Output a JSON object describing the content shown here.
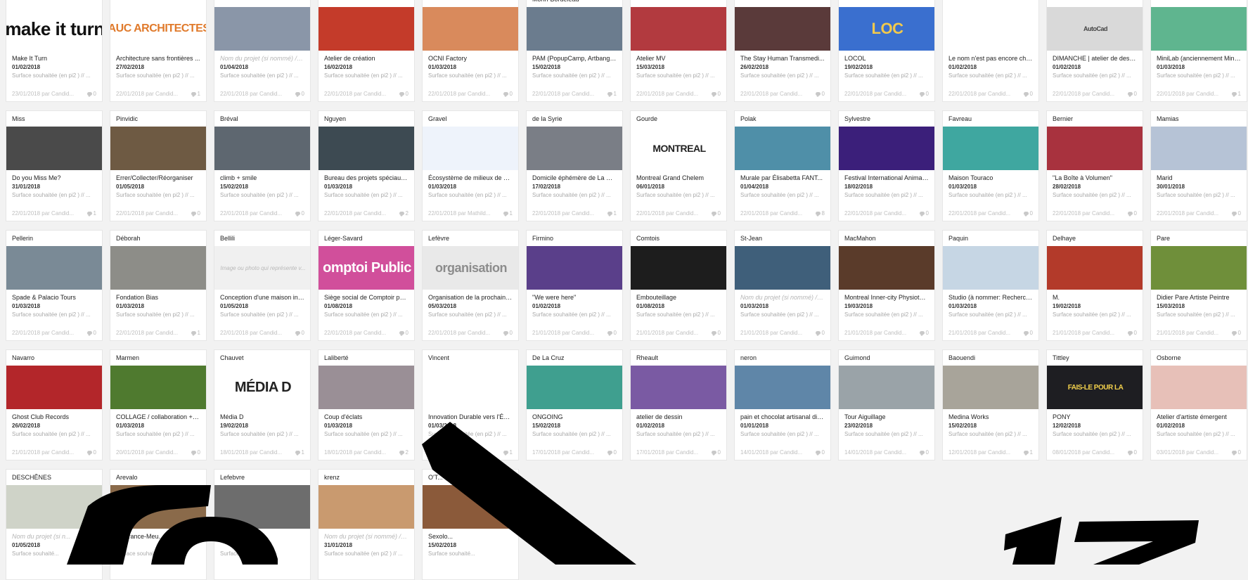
{
  "cards": [
    {
      "header": "",
      "title": "Make It Turn",
      "date": "01/02/2018",
      "surface": "Surface souhaitée (en pi2 ) // ...",
      "meta": "23/01/2018 par Candid...",
      "comments": "0",
      "thumb": {
        "bg": "#ffffff",
        "fg": "#111111",
        "label": "make it turn",
        "size": "26"
      }
    },
    {
      "header": "",
      "title": "Architecture sans frontières ...",
      "date": "27/02/2018",
      "surface": "Surface souhaitée (en pi2 ) // ...",
      "meta": "22/01/2018 par Candid...",
      "comments": "1",
      "thumb": {
        "bg": "#ffffff",
        "fg": "#e07a2b",
        "label": "AUC ARCHITECTES",
        "size": "16"
      }
    },
    {
      "header": "",
      "title": "Nom du projet (si nommé) // ...",
      "title_ph": true,
      "date": "01/04/2018",
      "surface": "Surface souhaitée (en pi2 ) // ...",
      "meta": "22/01/2018 par Candid...",
      "comments": "0",
      "thumb": {
        "bg": "#8a96a8",
        "fg": "#ffffff",
        "label": "",
        "size": "12"
      }
    },
    {
      "header": "",
      "title": "Atelier de création",
      "date": "16/02/2018",
      "surface": "Surface souhaitée (en pi2 ) // ...",
      "meta": "22/01/2018 par Candid...",
      "comments": "0",
      "thumb": {
        "bg": "#c43b2a",
        "fg": "#ffffff",
        "label": "",
        "size": "12"
      }
    },
    {
      "header": "",
      "title": "OCNI Factory",
      "date": "01/03/2018",
      "surface": "Surface souhaitée (en pi2 ) // ...",
      "meta": "22/01/2018 par Candid...",
      "comments": "0",
      "thumb": {
        "bg": "#d98a5c",
        "fg": "#ffffff",
        "label": "",
        "size": "12"
      }
    },
    {
      "header": "Morin-Bordeleau",
      "title": "PAM (PopupCamp, Artbangb...",
      "date": "15/02/2018",
      "surface": "Surface souhaitée (en pi2 ) // ...",
      "meta": "22/01/2018 par Candid...",
      "comments": "1",
      "thumb": {
        "bg": "#6b7c8e",
        "fg": "#ffffff",
        "label": "",
        "size": "12"
      }
    },
    {
      "header": "",
      "title": "Atelier MV",
      "date": "15/03/2018",
      "surface": "Surface souhaitée (en pi2 ) // ...",
      "meta": "22/01/2018 par Candid...",
      "comments": "0",
      "thumb": {
        "bg": "#b23a3f",
        "fg": "#ffffff",
        "label": "",
        "size": "12"
      }
    },
    {
      "header": "",
      "title": "The Stay Human Transmedi...",
      "date": "26/02/2018",
      "surface": "Surface souhaitée (en pi2 ) // ...",
      "meta": "22/01/2018 par Candid...",
      "comments": "0",
      "thumb": {
        "bg": "#5a3a3a",
        "fg": "#ffffff",
        "label": "",
        "size": "12"
      }
    },
    {
      "header": "",
      "title": "LOCOL",
      "date": "19/02/2018",
      "surface": "Surface souhaitée (en pi2 ) // ...",
      "meta": "22/01/2018 par Candid...",
      "comments": "0",
      "thumb": {
        "bg": "#3a6fcf",
        "fg": "#f2c94c",
        "label": "LOC",
        "size": "22"
      }
    },
    {
      "header": "",
      "title": "Le nom n'est pas encore cho...",
      "date": "01/02/2018",
      "surface": "Surface souhaitée (en pi2 ) // ...",
      "meta": "22/01/2018 par Candid...",
      "comments": "0",
      "thumb": {
        "bg": "#ffffff",
        "fg": "#ffffff",
        "label": "",
        "size": "12"
      }
    },
    {
      "header": "",
      "title": "DIMANCHE | atelier de desig...",
      "date": "01/02/2018",
      "surface": "Surface souhaitée (en pi2 ) // ...",
      "meta": "22/01/2018 par Candid...",
      "comments": "0",
      "thumb": {
        "bg": "#d9d9d9",
        "fg": "#444444",
        "label": "AutoCad",
        "size": "9"
      }
    },
    {
      "header": "",
      "title": "MiniLab (anciennement Mini ...",
      "date": "01/03/2018",
      "surface": "Surface souhaitée (en pi2 ) // ...",
      "meta": "22/01/2018 par Candid...",
      "comments": "1",
      "thumb": {
        "bg": "#5fb58f",
        "fg": "#ffffff",
        "label": "",
        "size": "12"
      }
    },
    {
      "header": "Miss",
      "title": "Do you Miss Me?",
      "date": "31/01/2018",
      "surface": "Surface souhaitée (en pi2 ) // ...",
      "meta": "22/01/2018 par Candid...",
      "comments": "1",
      "thumb": {
        "bg": "#4a4a4a",
        "fg": "#ffffff",
        "label": "",
        "size": "12"
      }
    },
    {
      "header": "Pinvidic",
      "title": "Errer/Collecter/Réorganiser",
      "date": "01/05/2018",
      "surface": "Surface souhaitée (en pi2 ) // ...",
      "meta": "22/01/2018 par Candid...",
      "comments": "0",
      "thumb": {
        "bg": "#6e5a43",
        "fg": "#ffffff",
        "label": "",
        "size": "12"
      }
    },
    {
      "header": "Bréval",
      "title": "climb + smile",
      "date": "15/02/2018",
      "surface": "Surface souhaitée (en pi2 ) // ...",
      "meta": "22/01/2018 par Candid...",
      "comments": "0",
      "thumb": {
        "bg": "#5e6770",
        "fg": "#ffffff",
        "label": "",
        "size": "12"
      }
    },
    {
      "header": "Nguyen",
      "title": "Bureau des projets spéciaux ...",
      "date": "01/03/2018",
      "surface": "Surface souhaitée (en pi2 ) // ...",
      "meta": "22/01/2018 par Candid...",
      "comments": "2",
      "thumb": {
        "bg": "#3d4a52",
        "fg": "#ffffff",
        "label": "",
        "size": "12"
      }
    },
    {
      "header": "Gravel",
      "title": "Écosystème de milieux de vi...",
      "date": "01/03/2018",
      "surface": "Surface souhaitée (en pi2 ) // ...",
      "meta": "22/01/2018 par Mathild...",
      "comments": "1",
      "thumb": {
        "bg": "#eef3fb",
        "fg": "#3a7bd5",
        "label": "",
        "size": "12"
      }
    },
    {
      "header": "de la Syrie",
      "title": "Domicile éphémère de La m...",
      "date": "17/02/2018",
      "surface": "Surface souhaitée (en pi2 ) // ...",
      "meta": "22/01/2018 par Candid...",
      "comments": "1",
      "thumb": {
        "bg": "#7a7e86",
        "fg": "#ffffff",
        "label": "",
        "size": "12"
      }
    },
    {
      "header": "Gourde",
      "title": "Montreal Grand Chelem",
      "date": "06/01/2018",
      "surface": "Surface souhaitée (en pi2 ) // ...",
      "meta": "22/01/2018 par Candid...",
      "comments": "0",
      "thumb": {
        "bg": "#ffffff",
        "fg": "#222222",
        "label": "MONTREAL",
        "size": "14"
      }
    },
    {
      "header": "Polak",
      "title": "Murale par Élisabetta FANT...",
      "date": "01/04/2018",
      "surface": "Surface souhaitée (en pi2 ) // ...",
      "meta": "22/01/2018 par Candid...",
      "comments": "8",
      "thumb": {
        "bg": "#4f8fa8",
        "fg": "#ffffff",
        "label": "",
        "size": "12"
      }
    },
    {
      "header": "Sylvestre",
      "title": "Festival International Animaze",
      "date": "18/02/2018",
      "surface": "Surface souhaitée (en pi2 ) // ...",
      "meta": "22/01/2018 par Candid...",
      "comments": "0",
      "thumb": {
        "bg": "#3b1f7a",
        "fg": "#ffffff",
        "label": "",
        "size": "12"
      }
    },
    {
      "header": "Favreau",
      "title": "Maison Touraco",
      "date": "01/03/2018",
      "surface": "Surface souhaitée (en pi2 ) // ...",
      "meta": "22/01/2018 par Candid...",
      "comments": "0",
      "thumb": {
        "bg": "#3fa7a0",
        "fg": "#ffffff",
        "label": "",
        "size": "12"
      }
    },
    {
      "header": "Bernier",
      "title": "\"La Boîte à Volumen\"",
      "date": "28/02/2018",
      "surface": "Surface souhaitée (en pi2 ) // ...",
      "meta": "22/01/2018 par Candid...",
      "comments": "0",
      "thumb": {
        "bg": "#a8323e",
        "fg": "#ffffff",
        "label": "",
        "size": "12"
      }
    },
    {
      "header": "Mamias",
      "title": "Marid",
      "date": "30/01/2018",
      "surface": "Surface souhaitée (en pi2 ) // ...",
      "meta": "22/01/2018 par Candid...",
      "comments": "0",
      "thumb": {
        "bg": "#b6c3d6",
        "fg": "#ffffff",
        "label": "",
        "size": "12"
      }
    },
    {
      "header": "Pellerin",
      "title": "Spade & Palacio Tours",
      "date": "01/03/2018",
      "surface": "Surface souhaitée (en pi2 ) // ...",
      "meta": "22/01/2018 par Candid...",
      "comments": "0",
      "thumb": {
        "bg": "#7a8a96",
        "fg": "#ffffff",
        "label": "",
        "size": "12"
      }
    },
    {
      "header": "Déborah",
      "title": "Fondation Bias",
      "date": "01/03/2018",
      "surface": "Surface souhaitée (en pi2 ) // ...",
      "meta": "22/01/2018 par Candid...",
      "comments": "1",
      "thumb": {
        "bg": "#8d8d88",
        "fg": "#ffffff",
        "label": "",
        "size": "12"
      }
    },
    {
      "header": "Bellili",
      "title": "Conception d'une maison int...",
      "date": "01/05/2018",
      "surface": "Surface souhaitée (en pi2 ) // ...",
      "meta": "22/01/2018 par Candid...",
      "comments": "0",
      "thumb": {
        "bg": "#f0f0f0",
        "fg": "#bbbbbb",
        "label": "",
        "placeholder": "Image ou photo qui représente v...",
        "size": "12"
      }
    },
    {
      "header": "Léger-Savard",
      "title": "Siège social de Comptoir pu...",
      "date": "01/08/2018",
      "surface": "Surface souhaitée (en pi2 ) // ...",
      "meta": "22/01/2018 par Candid...",
      "comments": "0",
      "thumb": {
        "bg": "#d14f9b",
        "fg": "#ffffff",
        "label": "omptoi Public",
        "size": "20"
      }
    },
    {
      "header": "Lefèvre",
      "title": "Organisation de la prochaine...",
      "date": "05/03/2018",
      "surface": "Surface souhaitée (en pi2 ) // ...",
      "meta": "22/01/2018 par Candid...",
      "comments": "0",
      "thumb": {
        "bg": "#e9e9e9",
        "fg": "#8c8c8c",
        "label": "organisation",
        "size": "18"
      }
    },
    {
      "header": "Firmino",
      "title": "\"We were here\"",
      "date": "01/02/2018",
      "surface": "Surface souhaitée (en pi2 ) // ...",
      "meta": "21/01/2018 par Candid...",
      "comments": "0",
      "thumb": {
        "bg": "#5a3f8a",
        "fg": "#ffffff",
        "label": "",
        "size": "12"
      }
    },
    {
      "header": "Comtois",
      "title": "Embouteillage",
      "date": "01/08/2018",
      "surface": "Surface souhaitée (en pi2 ) // ...",
      "meta": "21/01/2018 par Candid...",
      "comments": "0",
      "thumb": {
        "bg": "#1d1d1d",
        "fg": "#ffffff",
        "label": "",
        "size": "12"
      }
    },
    {
      "header": "St-Jean",
      "title": "Nom du projet (si nommé) // ...",
      "title_ph": true,
      "date": "01/03/2018",
      "surface": "Surface souhaitée (en pi2 ) // ...",
      "meta": "21/01/2018 par Candid...",
      "comments": "0",
      "thumb": {
        "bg": "#3f5f7a",
        "fg": "#ffffff",
        "label": "",
        "size": "12"
      }
    },
    {
      "header": "MacMahon",
      "title": "Montreal Inner-city Physiothe...",
      "date": "19/03/2018",
      "surface": "Surface souhaitée (en pi2 ) // ...",
      "meta": "21/01/2018 par Candid...",
      "comments": "0",
      "thumb": {
        "bg": "#5a3b2a",
        "fg": "#ffffff",
        "label": "",
        "size": "12"
      }
    },
    {
      "header": "Paquin",
      "title": "Studio (à nommer: Recherch...",
      "date": "01/03/2018",
      "surface": "Surface souhaitée (en pi2 ) // ...",
      "meta": "21/01/2018 par Candid...",
      "comments": "0",
      "thumb": {
        "bg": "#c6d6e4",
        "fg": "#ffffff",
        "label": "",
        "size": "12"
      }
    },
    {
      "header": "Delhaye",
      "title": "M.",
      "date": "19/02/2018",
      "surface": "Surface souhaitée (en pi2 ) // ...",
      "meta": "21/01/2018 par Candid...",
      "comments": "0",
      "thumb": {
        "bg": "#b33a2a",
        "fg": "#ffffff",
        "label": "",
        "size": "12"
      }
    },
    {
      "header": "Pare",
      "title": "Didier Pare Artiste Peintre",
      "date": "15/03/2018",
      "surface": "Surface souhaitée (en pi2 ) // ...",
      "meta": "21/01/2018 par Candid...",
      "comments": "0",
      "thumb": {
        "bg": "#6f8f3a",
        "fg": "#ffffff",
        "label": "",
        "size": "12"
      }
    },
    {
      "header": "Navarro",
      "title": "Ghost Club Records",
      "date": "26/02/2018",
      "surface": "Surface souhaitée (en pi2 ) // ...",
      "meta": "21/01/2018 par Candid...",
      "comments": "0",
      "thumb": {
        "bg": "#b3262a",
        "fg": "#ffffff",
        "label": "",
        "size": "12"
      }
    },
    {
      "header": "Marmen",
      "title": "COLLAGE / collaboration + p...",
      "date": "01/03/2018",
      "surface": "Surface souhaitée (en pi2 ) // ...",
      "meta": "20/01/2018 par Candid...",
      "comments": "0",
      "thumb": {
        "bg": "#4f7a2f",
        "fg": "#ffffff",
        "label": "",
        "size": "12"
      }
    },
    {
      "header": "Chauvet",
      "title": "Média D",
      "date": "19/02/2018",
      "surface": "Surface souhaitée (en pi2 ) // ...",
      "meta": "18/01/2018 par Candid...",
      "comments": "1",
      "thumb": {
        "bg": "#ffffff",
        "fg": "#222222",
        "label": "MÉDIA D",
        "size": "20"
      }
    },
    {
      "header": "Laliberté",
      "title": "Coup d'éclats",
      "date": "01/03/2018",
      "surface": "Surface souhaitée (en pi2 ) // ...",
      "meta": "18/01/2018 par Candid...",
      "comments": "2",
      "thumb": {
        "bg": "#9a8f96",
        "fg": "#ffffff",
        "label": "",
        "size": "12"
      }
    },
    {
      "header": "Vincent",
      "title": "Innovation Durable vers l'Éco...",
      "date": "01/03/2018",
      "surface": "Surface souhaitée (en pi2 ) // ...",
      "meta": "17/01/2018 par Candid...",
      "comments": "1",
      "thumb": {
        "bg": "#ffffff",
        "fg": "#ef8a2b",
        "label": "",
        "size": "12"
      }
    },
    {
      "header": "De La Cruz",
      "title": "ONGOING",
      "date": "15/02/2018",
      "surface": "Surface souhaitée (en pi2 ) // ...",
      "meta": "17/01/2018 par Candid...",
      "comments": "0",
      "thumb": {
        "bg": "#3f9f8f",
        "fg": "#ffffff",
        "label": "",
        "size": "12"
      }
    },
    {
      "header": "Rheault",
      "title": "atelier de dessin",
      "date": "01/02/2018",
      "surface": "Surface souhaitée (en pi2 ) // ...",
      "meta": "17/01/2018 par Candid...",
      "comments": "0",
      "thumb": {
        "bg": "#7a5aa3",
        "fg": "#ffffff",
        "label": "",
        "size": "12"
      }
    },
    {
      "header": "neron",
      "title": "pain et chocolat artisanal dist...",
      "date": "01/01/2018",
      "surface": "Surface souhaitée (en pi2 ) // ...",
      "meta": "14/01/2018 par Candid...",
      "comments": "0",
      "thumb": {
        "bg": "#5f86a8",
        "fg": "#ffffff",
        "label": "",
        "size": "12"
      }
    },
    {
      "header": "Guimond",
      "title": "Tour Aiguillage",
      "date": "23/02/2018",
      "surface": "Surface souhaitée (en pi2 ) // ...",
      "meta": "14/01/2018 par Candid...",
      "comments": "0",
      "thumb": {
        "bg": "#9aa3a8",
        "fg": "#ffffff",
        "label": "",
        "size": "12"
      }
    },
    {
      "header": "Baouendi",
      "title": "Medina Works",
      "date": "15/02/2018",
      "surface": "Surface souhaitée (en pi2 ) // ...",
      "meta": "12/01/2018 par Candid...",
      "comments": "1",
      "thumb": {
        "bg": "#a8a49a",
        "fg": "#ffffff",
        "label": "",
        "size": "12"
      }
    },
    {
      "header": "Tittley",
      "title": "PONY",
      "date": "12/02/2018",
      "surface": "Surface souhaitée (en pi2 ) // ...",
      "meta": "08/01/2018 par Candid...",
      "comments": "0",
      "thumb": {
        "bg": "#1e1e22",
        "fg": "#f2d04c",
        "label": "FAIS-LE POUR LA",
        "size": "10"
      }
    },
    {
      "header": "Osborne",
      "title": "Atelier d'artiste émergent",
      "date": "01/02/2018",
      "surface": "Surface souhaitée (en pi2 ) // ...",
      "meta": "03/01/2018 par Candid...",
      "comments": "0",
      "thumb": {
        "bg": "#e7c0b8",
        "fg": "#ffffff",
        "label": "",
        "size": "12"
      }
    },
    {
      "header": "DESCHÊNES",
      "title": "Nom du projet (si n...",
      "title_ph": true,
      "date": "01/05/2018",
      "surface": "Surface souhaité...",
      "meta": "",
      "comments": "",
      "thumb": {
        "bg": "#cfd3c8",
        "fg": "#ffffff",
        "label": "",
        "size": "12"
      }
    },
    {
      "header": "Arevalo",
      "title": "...pérance-Meu...",
      "date": "",
      "surface": "Surface souhaitée (en pi...",
      "meta": "",
      "comments": "",
      "thumb": {
        "bg": "#8a6a4a",
        "fg": "#ffffff",
        "label": "",
        "size": "12"
      }
    },
    {
      "header": "Lefebvre",
      "title": "",
      "date": "",
      "surface": "Surface ...",
      "meta": "",
      "comments": "",
      "thumb": {
        "bg": "#6d6d6d",
        "fg": "#ffffff",
        "label": "",
        "size": "12"
      }
    },
    {
      "header": "krenz",
      "title": "Nom du projet (si nommé) // ...",
      "title_ph": true,
      "date": "31/01/2018",
      "surface": "Surface souhaitée (en pi2 ) // ...",
      "meta": "",
      "comments": "",
      "thumb": {
        "bg": "#c99a6f",
        "fg": "#ffffff",
        "label": "",
        "size": "12"
      }
    },
    {
      "header": "O'T...",
      "title": "Sexolo...",
      "date": "15/02/2018",
      "surface": "Surface souhaité...",
      "meta": "",
      "comments": "",
      "thumb": {
        "bg": "#8b5a3a",
        "fg": "#ffffff",
        "label": "",
        "size": "12"
      }
    }
  ],
  "overlay": {
    "color": "#000000"
  }
}
